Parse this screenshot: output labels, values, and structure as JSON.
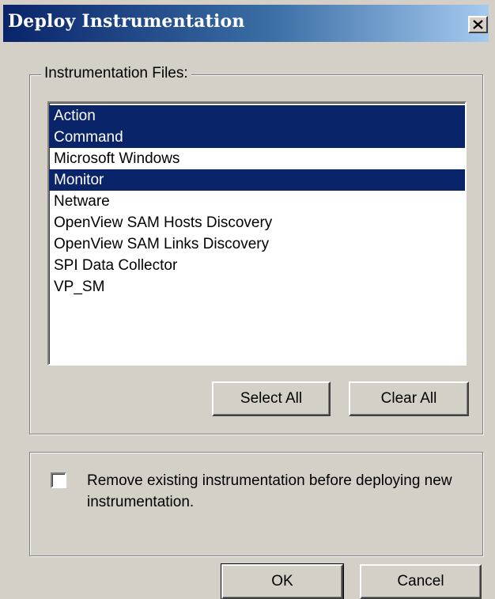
{
  "window": {
    "title": "Deploy Instrumentation",
    "close_symbol": "×"
  },
  "files_group": {
    "label": "Instrumentation Files:",
    "items": [
      {
        "label": "Action",
        "selected": true
      },
      {
        "label": "Command",
        "selected": true
      },
      {
        "label": "Microsoft Windows",
        "selected": false
      },
      {
        "label": "Monitor",
        "selected": true
      },
      {
        "label": "Netware",
        "selected": false
      },
      {
        "label": "OpenView SAM Hosts Discovery",
        "selected": false
      },
      {
        "label": "OpenView SAM Links Discovery",
        "selected": false
      },
      {
        "label": "SPI Data Collector",
        "selected": false
      },
      {
        "label": "VP_SM",
        "selected": false
      }
    ],
    "select_all_label": "Select All",
    "clear_all_label": "Clear All"
  },
  "options": {
    "remove_existing_label": "Remove existing instrumentation before deploying new instrumentation.",
    "remove_existing_checked": false
  },
  "footer": {
    "ok_label": "OK",
    "cancel_label": "Cancel"
  },
  "colors": {
    "selection_bg": "#0a246a",
    "title_gradient_start": "#0a246a",
    "title_gradient_end": "#a6caf0",
    "face": "#d4d0c8"
  },
  "icons": {
    "close": "close-icon"
  }
}
